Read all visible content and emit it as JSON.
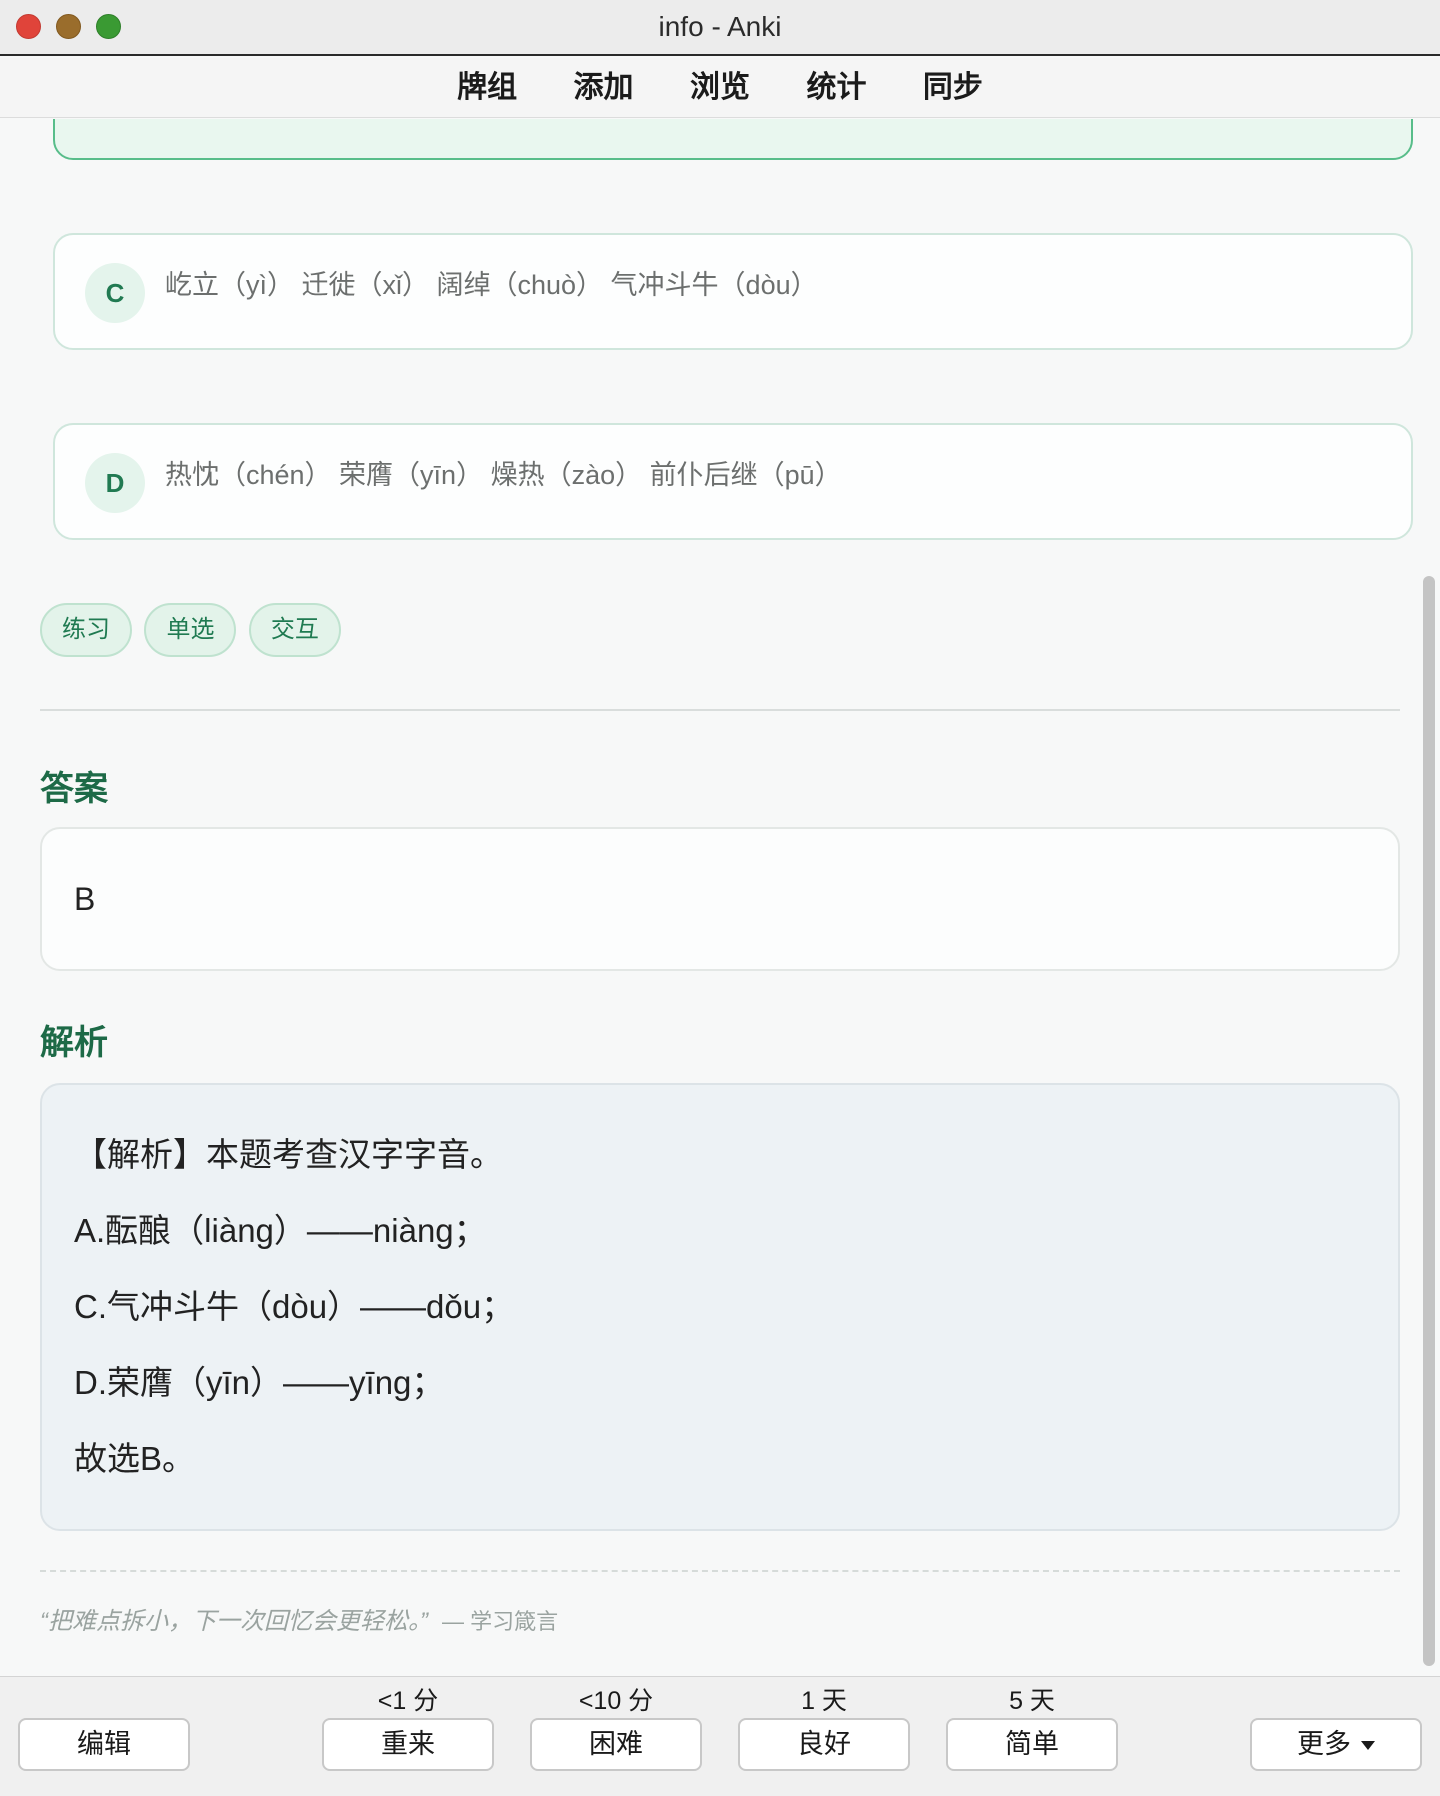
{
  "window": {
    "title": "info - Anki"
  },
  "toolbar": {
    "items": [
      "牌组",
      "添加",
      "浏览",
      "统计",
      "同步"
    ]
  },
  "options": [
    {
      "letter": "C",
      "text": "屹立（yì） 迁徙（xǐ） 阔绰（chuò） 气冲斗牛（dòu）"
    },
    {
      "letter": "D",
      "text": "热忱（chén） 荣膺（yīn） 燥热（zào） 前仆后继（pū）"
    }
  ],
  "tags": [
    "练习",
    "单选",
    "交互"
  ],
  "answer": {
    "title": "答案",
    "value": "B"
  },
  "analysis": {
    "title": "解析",
    "lines": [
      "【解析】本题考查汉字字音。",
      "A.酝酿（liàng）——niàng；",
      "C.气冲斗牛（dòu）——dǒu；",
      "D.荣膺（yīn）——yīng；",
      "故选B。"
    ]
  },
  "quote": {
    "text": "“把难点拆小，下一次回忆会更轻松。”",
    "source": "— 学习箴言"
  },
  "bottom": {
    "edit": "编辑",
    "again": {
      "label": "重来",
      "interval": "<1 分"
    },
    "hard": {
      "label": "困难",
      "interval": "<10 分"
    },
    "good": {
      "label": "良好",
      "interval": "1 天"
    },
    "easy": {
      "label": "简单",
      "interval": "5 天"
    },
    "more": "更多"
  },
  "colors": {
    "accent": "#2f9a65",
    "heading": "#1d6a47",
    "tag_bg": "#e3f3ea"
  }
}
